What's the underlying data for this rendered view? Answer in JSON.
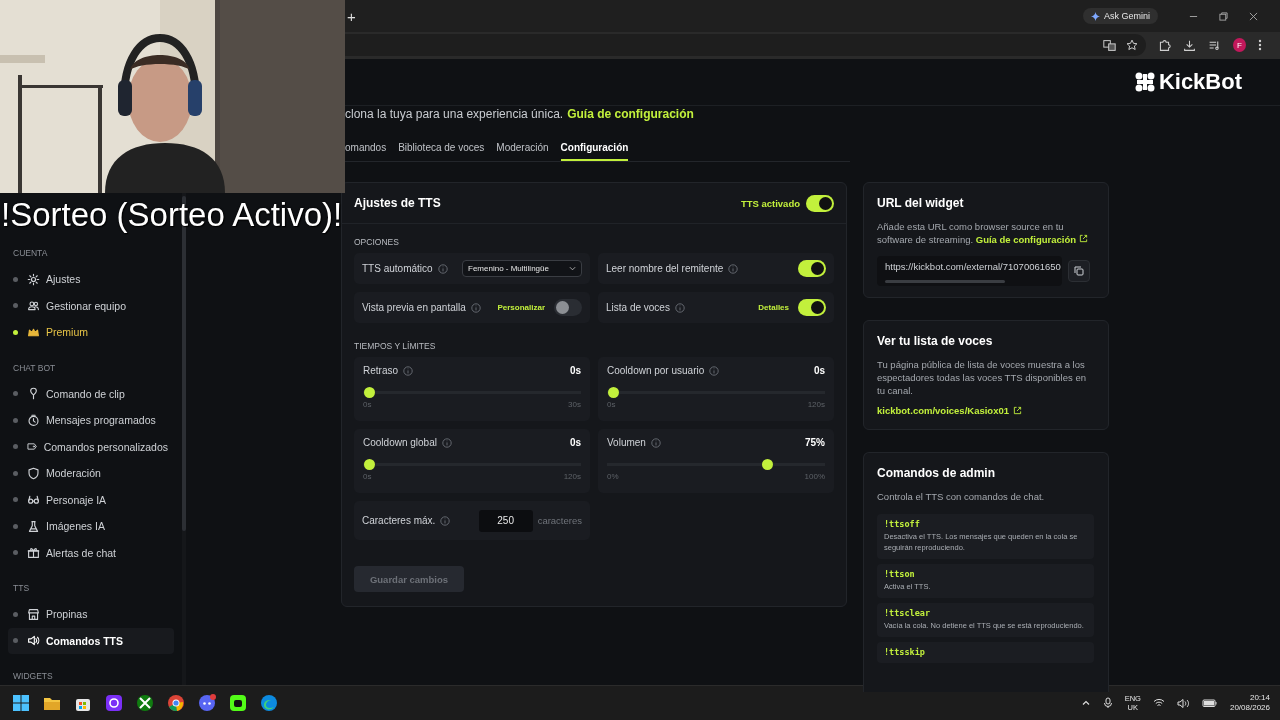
{
  "browser": {
    "new_tab": "+",
    "ask_button": "Ask Gemini",
    "profile_initial": "F"
  },
  "brand": {
    "name": "KickBot"
  },
  "overlay": {
    "text": "!Sorteo (Sorteo Activo)!"
  },
  "sidebar": {
    "sections": [
      {
        "title": "CUENTA",
        "items": [
          {
            "label": "Ajustes",
            "kind": "normal",
            "selected": false
          },
          {
            "label": "Gestionar equipo",
            "kind": "normal",
            "selected": false
          },
          {
            "label": "Premium",
            "kind": "premium",
            "selected": false
          }
        ]
      },
      {
        "title": "CHAT BOT",
        "items": [
          {
            "label": "Comando de clip",
            "kind": "normal",
            "selected": false
          },
          {
            "label": "Mensajes programados",
            "kind": "normal",
            "selected": false
          },
          {
            "label": "Comandos personalizados",
            "kind": "normal",
            "selected": false
          },
          {
            "label": "Moderación",
            "kind": "normal",
            "selected": false
          },
          {
            "label": "Personaje IA",
            "kind": "normal",
            "selected": false
          },
          {
            "label": "Imágenes IA",
            "kind": "normal",
            "selected": false
          },
          {
            "label": "Alertas de chat",
            "kind": "normal",
            "selected": false
          }
        ]
      },
      {
        "title": "TTS",
        "items": [
          {
            "label": "Propinas",
            "kind": "normal",
            "selected": false
          },
          {
            "label": "Comandos TTS",
            "kind": "normal",
            "selected": true
          }
        ]
      },
      {
        "title": "WIDGETS"
      }
    ]
  },
  "main": {
    "subtitle": {
      "text": "clona la tuya para una experiencia única.",
      "link": "Guía de configuración"
    },
    "tabs": [
      {
        "label": "omandos",
        "selected": false
      },
      {
        "label": "Biblioteca de voces",
        "selected": false
      },
      {
        "label": "Moderación",
        "selected": false
      },
      {
        "label": "Configuración",
        "selected": true
      }
    ]
  },
  "tts_card": {
    "title": "Ajustes de TTS",
    "master_toggle": {
      "label": "TTS activado",
      "on": true
    },
    "options_title": "OPCIONES",
    "options": [
      {
        "kind": "select",
        "label": "TTS automático",
        "value": "Femenino - Multilingüe"
      },
      {
        "kind": "toggle",
        "label": "Leer nombre del remitente",
        "on": true
      },
      {
        "kind": "toggle",
        "label": "Vista previa en pantalla",
        "link": "Personalizar",
        "on": false
      },
      {
        "kind": "toggle",
        "label": "Lista de voces",
        "link": "Detalles",
        "on": true
      }
    ],
    "limits_title": "TIEMPOS Y LÍMITES",
    "sliders": [
      {
        "label": "Retraso",
        "reading": "0s",
        "min": "0s",
        "max": "30s",
        "level": 0
      },
      {
        "label": "Cooldown por usuario",
        "reading": "0s",
        "min": "0s",
        "max": "120s",
        "level": 0
      },
      {
        "label": "Cooldown global",
        "reading": "0s",
        "min": "0s",
        "max": "120s",
        "level": 0
      },
      {
        "label": "Volumen",
        "reading": "75%",
        "min": "0%",
        "max": "100%",
        "level": 0.75
      }
    ],
    "max_chars": {
      "label": "Caracteres máx.",
      "value": "250",
      "unit": "caracteres"
    },
    "save_button": {
      "label": "Guardar cambios",
      "disabled": true
    }
  },
  "widget_url": {
    "title": "URL del widget",
    "description": "Añade esta URL como browser source en tu software de streaming.",
    "link": "Guía de configuración",
    "url": "https://kickbot.com/external/71070061650"
  },
  "voice_list": {
    "title": "Ver tu lista de voces",
    "description": "Tu página pública de lista de voces muestra a los espectadores todas las voces TTS disponibles en tu canal.",
    "link": "kickbot.com/voices/Kasiox01"
  },
  "admin_commands": {
    "title": "Comandos de admin",
    "description": "Controla el TTS con comandos de chat.",
    "commands": [
      {
        "command": "!ttsoff",
        "description": "Desactiva el TTS. Los mensajes que queden en la cola se seguirán reproduciendo."
      },
      {
        "command": "!ttson",
        "description": "Activa el TTS."
      },
      {
        "command": "!ttsclear",
        "description": "Vacía la cola. No detiene el TTS que se está reproduciendo."
      },
      {
        "command": "!ttsskip"
      }
    ]
  },
  "taskbar": {
    "language": "ENG",
    "region": "UK",
    "time": "20:14",
    "date": "20/08/2026"
  }
}
